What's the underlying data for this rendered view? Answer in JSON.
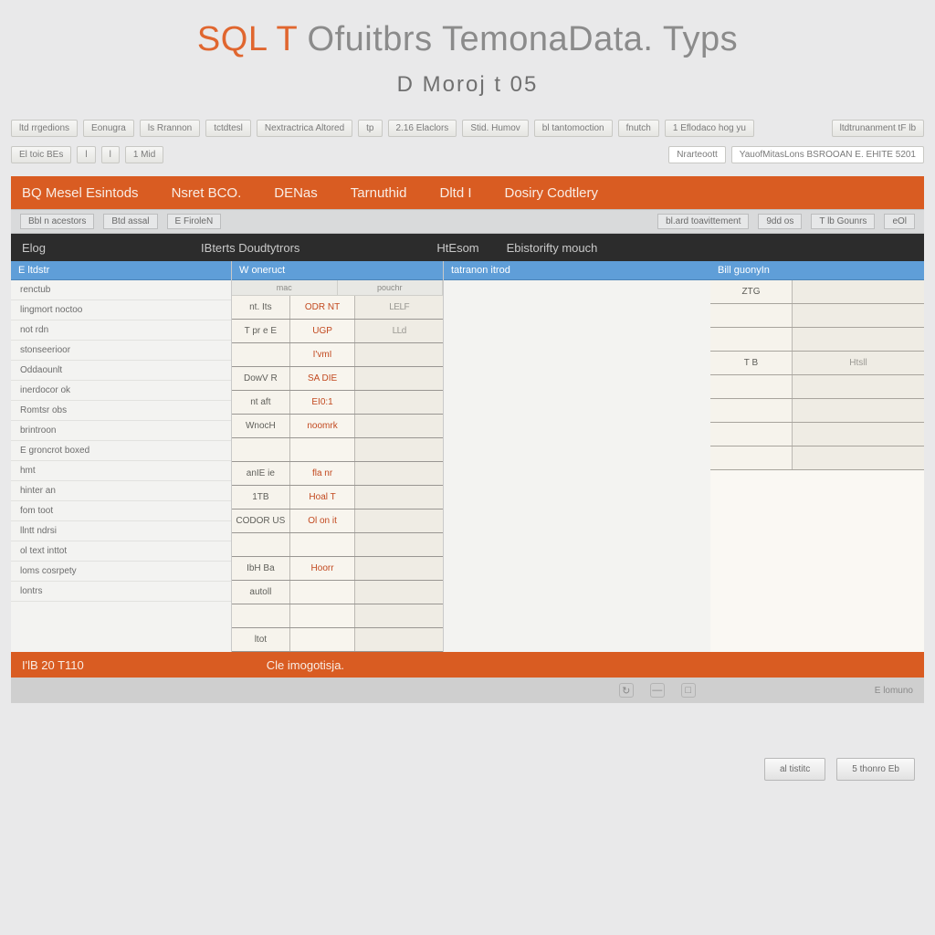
{
  "title": {
    "part1": "SQL",
    "part2": "T",
    "part3": "Ofuitbrs TemonaData. Typs",
    "subtitle": "D Moroj t 05"
  },
  "toolbar1": {
    "items": [
      "ltd rrgedions",
      "Eonugra",
      "ls Rrannon",
      "tctdtesl",
      "Nextractrica Altored",
      "tp",
      "2.16 Elaclors",
      "Stid. Humov",
      "bl tantomoction",
      "fnutch",
      "1 Eflodaco hog yu",
      "ltdtrunanment tF lb"
    ]
  },
  "toolbar2": {
    "left": [
      "El toic BEs",
      "l",
      "l",
      "1 Mid"
    ],
    "right_label": "Nrarteoott",
    "right_value": "YauofMitasLons BSROOAN E. EHITE  5201"
  },
  "tabs": {
    "items": [
      "BQ  Mesel Esintods",
      "Nsret BCO.",
      "DENas",
      "Tarnuthid",
      "Dltd I",
      "Dosiry Codtlery"
    ]
  },
  "grey_strip": {
    "items": [
      "Bbl n acestors",
      "Btd  assal",
      "E FiroleN",
      "bl.ard toavittement",
      "9dd os",
      "T lb Gounrs",
      "eOl"
    ]
  },
  "dark_strip": {
    "items": [
      "Elog",
      "IBterts Doudtytrors",
      "HtEsom",
      "Ebistorifty mouch"
    ]
  },
  "left_header": "E ltdstr",
  "left_rows": [
    "renctub",
    "lingmort noctoo",
    "not rdn",
    "stonseerioor",
    "Oddaounlt",
    "inerdocor ok",
    "Romtsr obs",
    "brintroon",
    "E groncrot boxed",
    "hmt",
    "hinter an",
    "fom toot",
    "llntt ndrsi",
    "ol text inttot",
    "loms cosrpety",
    "lontrs"
  ],
  "mid_header": "W oneruct",
  "mid_sub_cols": [
    "mac",
    "pouchr"
  ],
  "mid_rows": [
    {
      "c1": "nt. Its",
      "c2": "ODR NT",
      "c3": "LELF"
    },
    {
      "c1": "T pr e E",
      "c2": "UGP",
      "c3": "LLd"
    },
    {
      "c1": "",
      "c2": "I'vmI",
      "c3": ""
    },
    {
      "c1": "DowV R",
      "c2": "SA DIE",
      "c3": ""
    },
    {
      "c1": "nt aft",
      "c2": "EI0:1",
      "c3": ""
    },
    {
      "c1": "WnocH",
      "c2": "noomrk",
      "c3": ""
    },
    {
      "c1": "",
      "c2": "",
      "c3": ""
    },
    {
      "c1": "anIE ie",
      "c2": "fla nr",
      "c3": ""
    },
    {
      "c1": "1TB",
      "c2": "Hoal T",
      "c3": ""
    },
    {
      "c1": "CODOR US",
      "c2": "Ol on it",
      "c3": ""
    },
    {
      "c1": "",
      "c2": "",
      "c3": ""
    },
    {
      "c1": "IbH Ba",
      "c2": "Hoorr",
      "c3": ""
    },
    {
      "c1": "autoll",
      "c2": "",
      "c3": ""
    },
    {
      "c1": "",
      "c2": "",
      "c3": ""
    },
    {
      "c1": "ltot",
      "c2": "",
      "c3": ""
    }
  ],
  "gap_header": "tatranon itrod",
  "right_header": "Bill guonyIn",
  "right_rows": [
    {
      "r1": "ZTG",
      "r2": ""
    },
    {
      "r1": "",
      "r2": ""
    },
    {
      "r1": "",
      "r2": ""
    },
    {
      "r1": "T B",
      "r2": "Htsll"
    },
    {
      "r1": "",
      "r2": ""
    },
    {
      "r1": "",
      "r2": ""
    },
    {
      "r1": "",
      "r2": ""
    },
    {
      "r1": "",
      "r2": ""
    }
  ],
  "footer": {
    "left": "I'lB 20 T110",
    "center": "Cle imogotisja.",
    "icons": [
      "↻",
      "—",
      "□"
    ],
    "right": "E lomuno"
  },
  "bottom_buttons": {
    "ok": "al tistitc",
    "cancel": "5 thonro Eb"
  }
}
